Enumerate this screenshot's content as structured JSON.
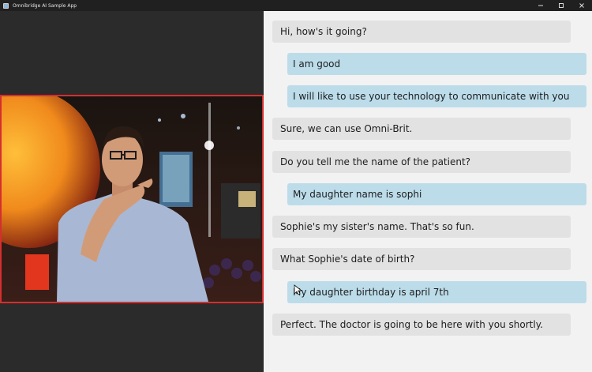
{
  "window": {
    "title": "Omnibridge AI Sample App",
    "controls": [
      "minimize-icon",
      "maximize-icon",
      "close-icon"
    ]
  },
  "video": {
    "border_color": "#d42f2f"
  },
  "chat": {
    "messages": [
      {
        "sender": "other",
        "text": "Hi, how's it going?"
      },
      {
        "sender": "self",
        "text": "I am good"
      },
      {
        "sender": "self",
        "text": "I will like to use your technology to communicate with you"
      },
      {
        "sender": "other",
        "text": "Sure, we can use Omni-Brit."
      },
      {
        "sender": "other",
        "text": "Do you tell me the name of the patient?"
      },
      {
        "sender": "self",
        "text": "My daughter name is sophi"
      },
      {
        "sender": "other",
        "text": "Sophie's my sister's name. That's so fun."
      },
      {
        "sender": "other",
        "text": "What Sophie's date of birth?"
      },
      {
        "sender": "self",
        "text": "My daughter birthday is april 7th"
      },
      {
        "sender": "other",
        "text": "Perfect. The doctor is going to be here with you shortly."
      }
    ]
  },
  "colors": {
    "other_bubble": "#e2e2e2",
    "self_bubble": "#bcdcea",
    "panel_bg": "#f2f2f2",
    "left_bg": "#2b2b2b"
  }
}
